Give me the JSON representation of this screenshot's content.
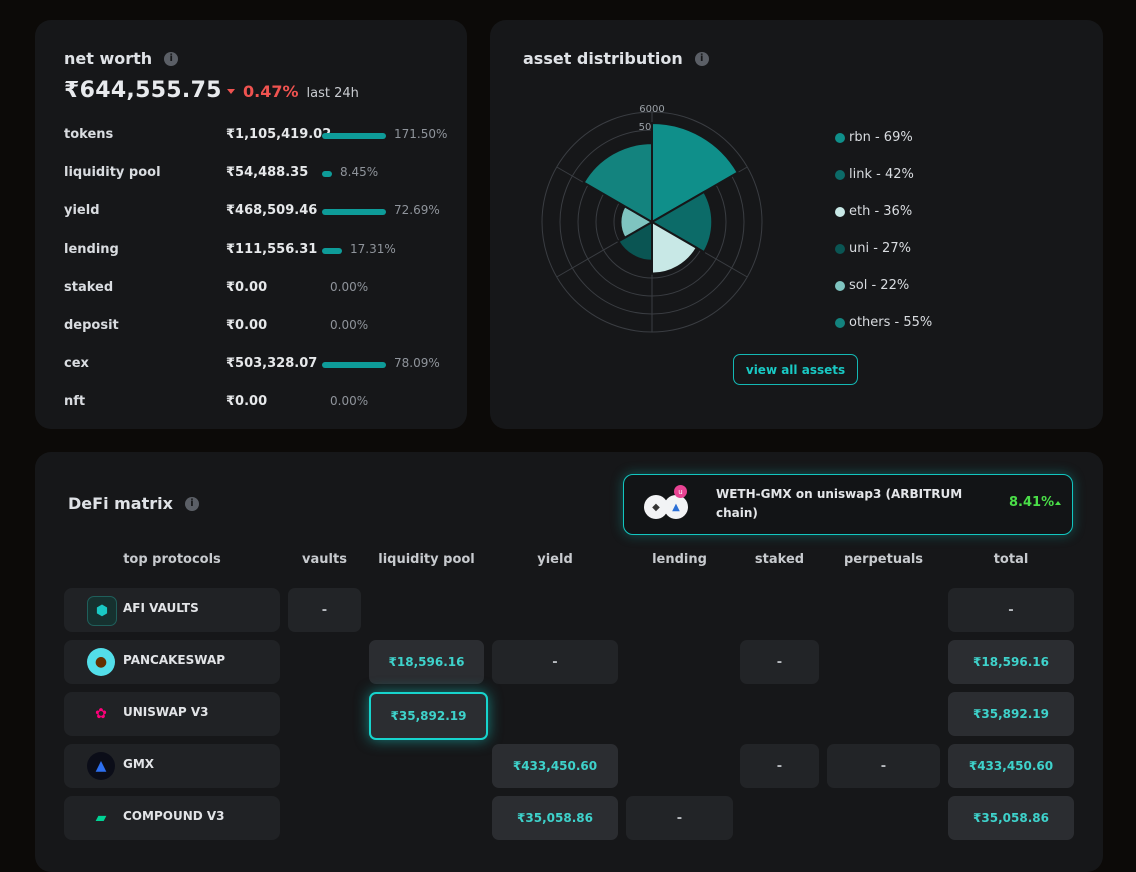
{
  "net_worth": {
    "title": "net worth",
    "value": "₹644,555.75",
    "change_pct": "0.47%",
    "change_period": "last 24h",
    "rows": [
      {
        "label": "tokens",
        "amount": "₹1,105,419.02",
        "pct": "171.50%",
        "fill": 1.0
      },
      {
        "label": "liquidity pool",
        "amount": "₹54,488.35",
        "pct": "8.45%",
        "fill": 0.12
      },
      {
        "label": "yield",
        "amount": "₹468,509.46",
        "pct": "72.69%",
        "fill": 1.0
      },
      {
        "label": "lending",
        "amount": "₹111,556.31",
        "pct": "17.31%",
        "fill": 0.31
      },
      {
        "label": "staked",
        "amount": "₹0.00",
        "pct": "0.00%",
        "fill": 0
      },
      {
        "label": "deposit",
        "amount": "₹0.00",
        "pct": "0.00%",
        "fill": 0
      },
      {
        "label": "cex",
        "amount": "₹503,328.07",
        "pct": "78.09%",
        "fill": 1.0
      },
      {
        "label": "nft",
        "amount": "₹0.00",
        "pct": "0.00%",
        "fill": 0
      }
    ]
  },
  "asset_distribution": {
    "title": "asset distribution",
    "ring_labels": [
      "6000",
      "50"
    ],
    "legend": [
      {
        "label": "rbn - 69%",
        "color": "#0f8f8a"
      },
      {
        "label": "link - 42%",
        "color": "#0c6b68"
      },
      {
        "label": "eth - 36%",
        "color": "#c8e8e6"
      },
      {
        "label": "uni - 27%",
        "color": "#0a5553"
      },
      {
        "label": "sol - 22%",
        "color": "#7fc4c0"
      },
      {
        "label": "others - 55%",
        "color": "#13837e"
      }
    ],
    "view_all_label": "view all assets"
  },
  "defi": {
    "title": "DeFi matrix",
    "highlight": {
      "text": "WETH-GMX on uniswap3 (ARBITRUM chain)",
      "pct": "8.41%"
    },
    "columns": [
      "top protocols",
      "vaults",
      "liquidity pool",
      "yield",
      "lending",
      "staked",
      "perpetuals",
      "total"
    ],
    "rows": [
      {
        "name": "AFI VAULTS",
        "icon": "afi-vaults-icon",
        "vaults": "-",
        "total": "-"
      },
      {
        "name": "PANCAKESWAP",
        "icon": "pancakeswap-icon",
        "liquidity_pool": "₹18,596.16",
        "yield": "-",
        "staked": "-",
        "total": "₹18,596.16"
      },
      {
        "name": "UNISWAP V3",
        "icon": "uniswap-icon",
        "liquidity_pool": "₹35,892.19",
        "total": "₹35,892.19"
      },
      {
        "name": "GMX",
        "icon": "gmx-icon",
        "yield": "₹433,450.60",
        "staked": "-",
        "perpetuals": "-",
        "total": "₹433,450.60"
      },
      {
        "name": "COMPOUND V3",
        "icon": "compound-icon",
        "yield": "₹35,058.86",
        "lending": "-",
        "total": "₹35,058.86"
      }
    ]
  }
}
